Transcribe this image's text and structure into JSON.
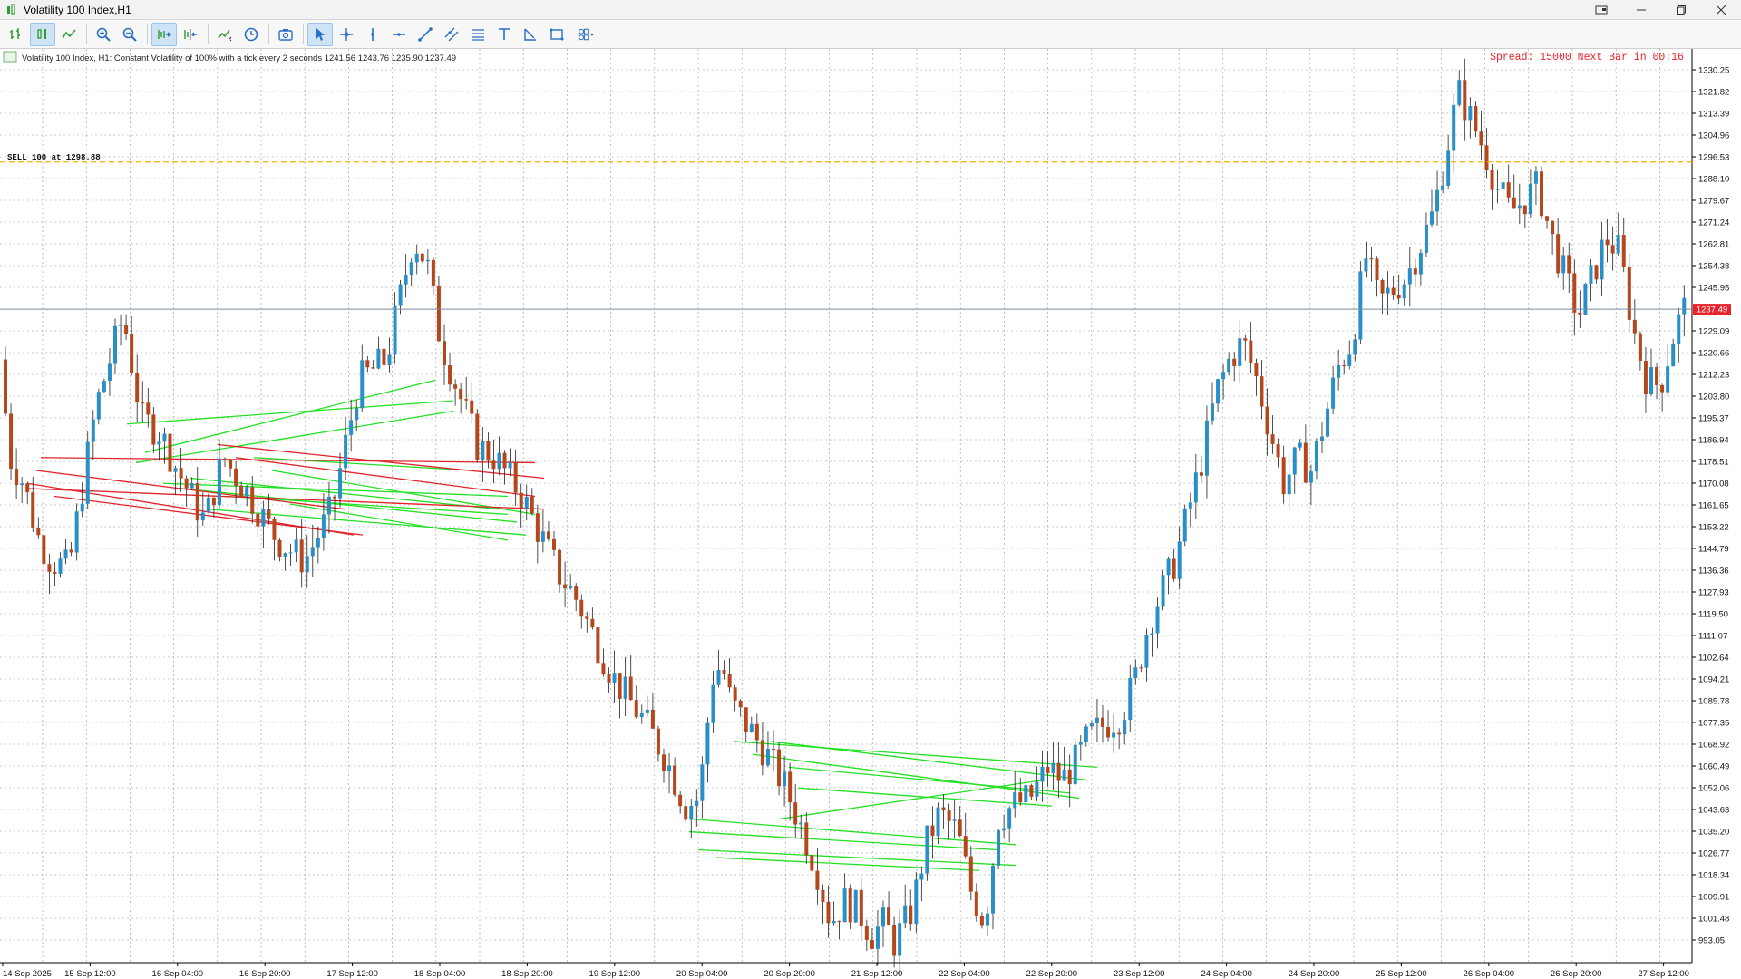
{
  "window": {
    "title": "Volatility 100 Index,H1"
  },
  "toolbar": {
    "items": [
      {
        "name": "bar-chart-icon"
      },
      {
        "name": "candlestick-icon",
        "active": true
      },
      {
        "name": "line-chart-icon"
      },
      {
        "name": "zoom-in-icon"
      },
      {
        "name": "zoom-out-icon"
      },
      {
        "name": "auto-scroll-icon",
        "active": true
      },
      {
        "name": "chart-shift-icon"
      },
      {
        "name": "indicators-icon"
      },
      {
        "name": "timeframe-clock-icon"
      },
      {
        "name": "screenshot-icon"
      },
      {
        "name": "cursor-icon",
        "active": true
      },
      {
        "name": "crosshair-icon"
      },
      {
        "name": "vertical-line-icon"
      },
      {
        "name": "horizontal-line-icon"
      },
      {
        "name": "trend-line-icon"
      },
      {
        "name": "equidistant-channel-icon"
      },
      {
        "name": "fibonacci-icon"
      },
      {
        "name": "text-icon"
      },
      {
        "name": "arrow-label-icon"
      },
      {
        "name": "rectangle-icon"
      },
      {
        "name": "shapes-icon"
      }
    ]
  },
  "chart": {
    "info_line": "Volatility 100 Index, H1:  Constant Volatility of 100% with a tick every 2 seconds  1241.56 1243.76 1235.90 1237.49",
    "spread_text": "Spread: 15000 Next Bar in 00:16",
    "sell_label": "SELL 100 at 1298.88",
    "current_price_label": "1237.49",
    "colors": {
      "bull": "#2a8fc7",
      "bear": "#b5471d",
      "grid": "#9a9a9a",
      "sell_line": "#f0b400",
      "price_line": "#7c8aa0",
      "price_tag": "#e8232b",
      "spread_text": "#e8232b",
      "win_trade": "#22e122",
      "loss_trade": "#e0242c"
    },
    "price_axis_labels": [
      "1330.25",
      "1321.82",
      "1313.39",
      "1304.96",
      "1296.53",
      "1288.10",
      "1279.67",
      "1271.24",
      "1262.81",
      "1254.38",
      "1245.95",
      "1229.09",
      "1220.66",
      "1212.23",
      "1203.80",
      "1195.37",
      "1186.94",
      "1178.51",
      "1170.08",
      "1161.65",
      "1153.22",
      "1144.79",
      "1136.36",
      "1127.93",
      "1119.50",
      "1111.07",
      "1102.64",
      "1094.21",
      "1085.78",
      "1077.35",
      "1068.92",
      "1060.49",
      "1052.06",
      "1043.63",
      "1035.20",
      "1026.77",
      "1018.34",
      "1009.91",
      "1001.48",
      "993.05"
    ],
    "time_axis_labels": [
      "14 Sep 2025",
      "15 Sep 12:00",
      "16 Sep 04:00",
      "16 Sep 20:00",
      "17 Sep 12:00",
      "18 Sep 04:00",
      "18 Sep 20:00",
      "19 Sep 12:00",
      "20 Sep 04:00",
      "20 Sep 20:00",
      "21 Sep 12:00",
      "22 Sep 04:00",
      "22 Sep 20:00",
      "23 Sep 12:00",
      "24 Sep 04:00",
      "24 Sep 20:00",
      "25 Sep 12:00",
      "26 Sep 04:00",
      "26 Sep 20:00",
      "27 Sep 12:00"
    ]
  }
}
